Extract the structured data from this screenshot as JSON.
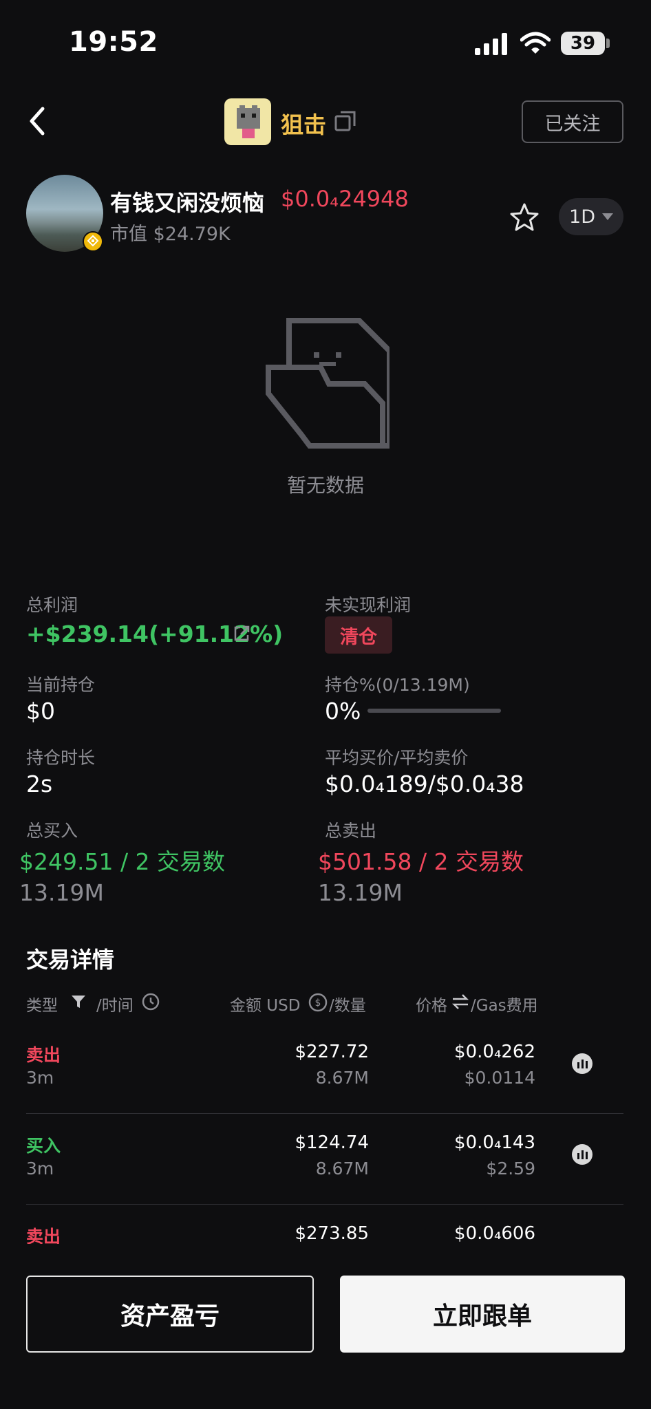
{
  "status_bar": {
    "time": "19:52",
    "battery": "39"
  },
  "header": {
    "sniper_label": "狙击",
    "follow_label": "已关注"
  },
  "token": {
    "name": "有钱又闲没烦恼",
    "price": "$0.0₄24948",
    "market_cap": "市值 $24.79K",
    "range": "1D"
  },
  "empty_state": {
    "text": "暂无数据"
  },
  "stats": {
    "total_profit_label": "总利润",
    "total_profit_value": "+$239.14(+91.12%)",
    "unrealized_label": "未实现利润",
    "unrealized_badge": "清仓",
    "position_label": "当前持仓",
    "position_value": "$0",
    "holding_pct_label": "持仓%(0/13.19M)",
    "holding_pct_value": "0%",
    "holding_pct_fraction": 0,
    "duration_label": "持仓时长",
    "duration_value": "2s",
    "avg_price_label": "平均买价/平均卖价",
    "avg_price_value": "$0.0₄189/$0.0₄38",
    "total_buy_label": "总买入",
    "total_buy_value": "$249.51 / 2 交易数",
    "total_buy_qty": "13.19M",
    "total_sell_label": "总卖出",
    "total_sell_value": "$501.58 / 2 交易数",
    "total_sell_qty": "13.19M"
  },
  "trades": {
    "title": "交易详情",
    "headers": {
      "type": "类型",
      "time": "/时间",
      "amount": "金额 USD",
      "qty": "/数量",
      "price": "价格",
      "gas": "/Gas费用"
    },
    "rows": [
      {
        "type": "卖出",
        "side": "sell",
        "time": "3m",
        "amount": "$227.72",
        "qty": "8.67M",
        "price": "$0.0₄262",
        "gas": "$0.0114"
      },
      {
        "type": "买入",
        "side": "buy",
        "time": "3m",
        "amount": "$124.74",
        "qty": "8.67M",
        "price": "$0.0₄143",
        "gas": "$2.59"
      },
      {
        "type": "卖出",
        "side": "sell",
        "time": "",
        "amount": "$273.85",
        "qty": "",
        "price": "$0.0₄606",
        "gas": ""
      }
    ]
  },
  "actions": {
    "pnl_label": "资产盈亏",
    "copy_label": "立即跟单"
  }
}
